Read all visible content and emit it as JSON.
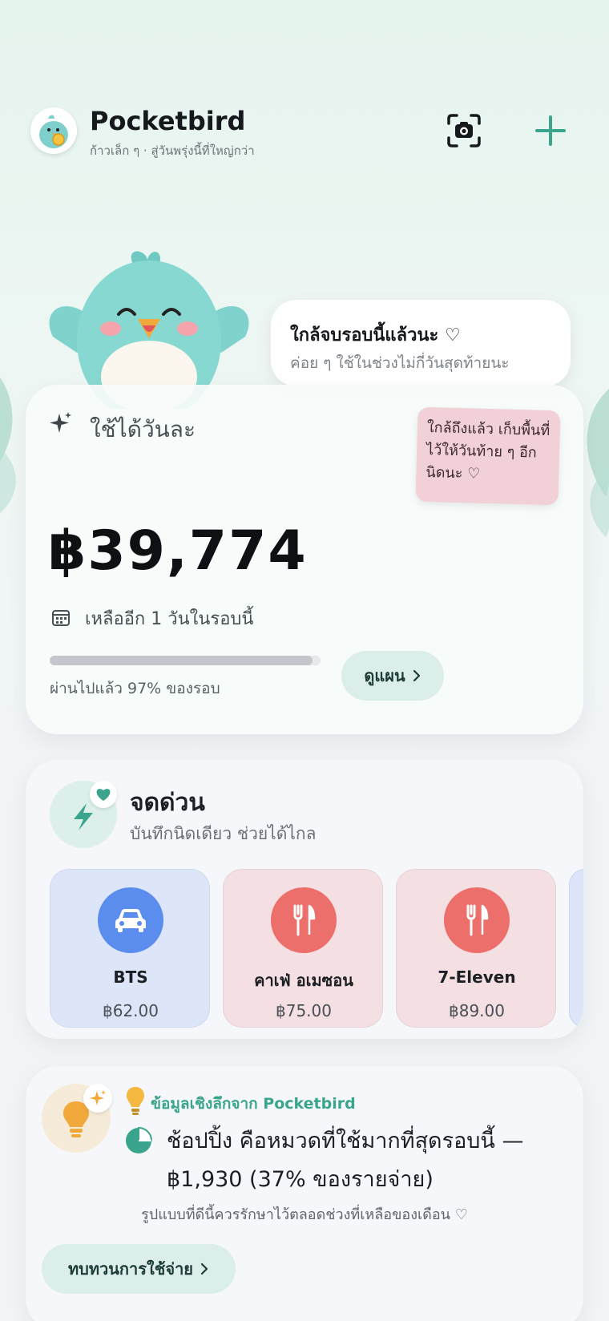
{
  "header": {
    "app_title": "Pocketbird",
    "tagline": "ก้าวเล็ก ๆ · สู่วันพรุ่งนี้ที่ใหญ่กว่า",
    "camera_icon": "camera-scan-icon",
    "add_icon": "plus-icon"
  },
  "bubble": {
    "title": "ใกล้จบรอบนี้แล้วนะ ♡",
    "subtitle": "ค่อย ๆ ใช้ในช่วงไม่กี่วันสุดท้ายนะ"
  },
  "budget": {
    "label": "ใช้ได้วันละ",
    "sticky_note": "ใกล้ถึงแล้ว เก็บพื้นที่ไว้ให้วันท้าย ๆ อีกนิดนะ ♡",
    "amount": "฿39,774",
    "remaining": "เหลืออีก 1 วันในรอบนี้",
    "progress_fraction": 0.97,
    "progress_text": "ผ่านไปแล้ว 97% ของรอบ",
    "plan_button": "ดูแผน"
  },
  "quick": {
    "title": "จดด่วน",
    "subtitle": "บันทึกนิดเดียว ช่วยได้ไกล",
    "tiles": [
      {
        "name": "BTS",
        "amount": "฿62.00",
        "icon": "car-icon",
        "bg": "#dde6f8",
        "circle": "#5b8def"
      },
      {
        "name": "คาเฟ่ อเมซอน",
        "amount": "฿75.00",
        "icon": "utensils-icon",
        "bg": "#f4dfe2",
        "circle": "#ec6f6c"
      },
      {
        "name": "7-Eleven",
        "amount": "฿89.00",
        "icon": "utensils-icon",
        "bg": "#f4dfe2",
        "circle": "#ec6f6c"
      }
    ]
  },
  "insight": {
    "heading": "ข้อมูลเชิงลึกจาก Pocketbird",
    "main": "ช้อปปิ้ง คือหมวดที่ใช้มากที่สุดรอบนี้ — ฿1,930 (37% ของรายจ่าย)",
    "note": "รูปแบบที่ดีนี้ควรรักษาไว้ตลอดช่วงที่เหลือของเดือน ♡",
    "review_button": "ทบทวนการใช้จ่าย"
  },
  "colors": {
    "accent": "#3aa58c",
    "button_bg": "#dbeeea"
  }
}
